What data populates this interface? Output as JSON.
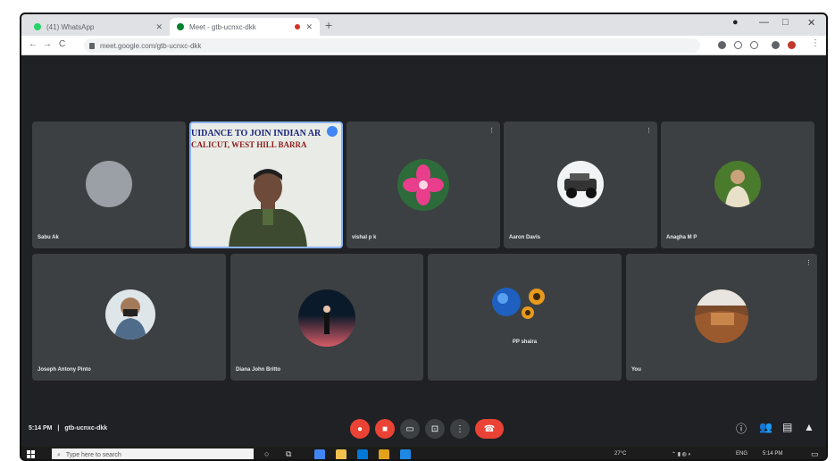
{
  "browser": {
    "tabs": [
      {
        "title": "(41) WhatsApp",
        "active": false
      },
      {
        "title": "Meet - gtb-ucnxc-dkk",
        "active": true
      }
    ],
    "url": "meet.google.com/gtb-ucnxc-dkk"
  },
  "tiles": [
    {
      "name": "Sabu Ak"
    },
    {
      "name": "",
      "banner_line1": "UIDANCE TO JOIN INDIAN AR",
      "banner_line2": "CALICUT, WEST HILL BARRA"
    },
    {
      "name": "vishal p k"
    },
    {
      "name": "Aaron Davis"
    },
    {
      "name": "Anagha M P"
    },
    {
      "name": "Joseph Antony Pinto"
    },
    {
      "name": "Diana John Britto"
    },
    {
      "name": "PP shaira"
    },
    {
      "name": "You"
    }
  ],
  "meeting": {
    "time": "5:14 PM",
    "separator": "|",
    "code": "gtb-ucnxc-dkk"
  },
  "taskbar": {
    "search_placeholder": "Type here to search",
    "weather": "27°C",
    "language": "ENG",
    "clock": "5:14 PM"
  },
  "colors": {
    "meet_background": "#202124",
    "tile": "#3c4043",
    "end_call": "#ea4335"
  }
}
